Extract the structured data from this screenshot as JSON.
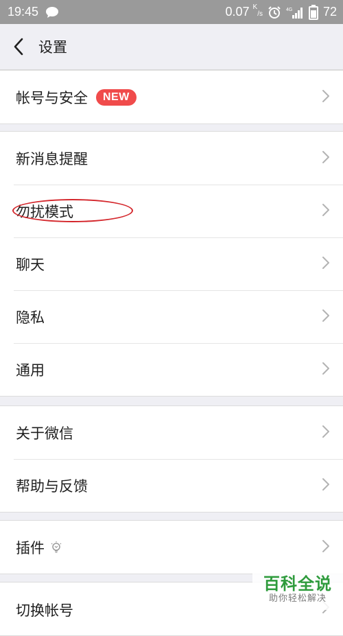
{
  "status_bar": {
    "time": "19:45",
    "net_speed": "0.07",
    "net_unit_top": "K",
    "net_unit_bottom": "/s",
    "battery": "72",
    "icons": [
      "chat-bubble-icon",
      "alarm-icon",
      "4g-signal-icon",
      "battery-icon"
    ]
  },
  "header": {
    "title": "设置"
  },
  "groups": [
    {
      "items": [
        {
          "label": "帐号与安全",
          "badge": "NEW"
        }
      ]
    },
    {
      "items": [
        {
          "label": "新消息提醒"
        },
        {
          "label": "勿扰模式"
        },
        {
          "label": "聊天"
        },
        {
          "label": "隐私"
        },
        {
          "label": "通用"
        }
      ]
    },
    {
      "items": [
        {
          "label": "关于微信"
        },
        {
          "label": "帮助与反馈"
        }
      ]
    },
    {
      "items": [
        {
          "label": "插件"
        }
      ]
    },
    {
      "items": [
        {
          "label": "切换帐号"
        }
      ]
    }
  ],
  "watermark": {
    "title": "百科全说",
    "subtitle": "助你轻松解决"
  },
  "colors": {
    "accent_badge": "#f04b4b",
    "annotation": "#d4262b",
    "watermark_green": "#2e9b3c",
    "statusbar": "#9a9a9a"
  }
}
